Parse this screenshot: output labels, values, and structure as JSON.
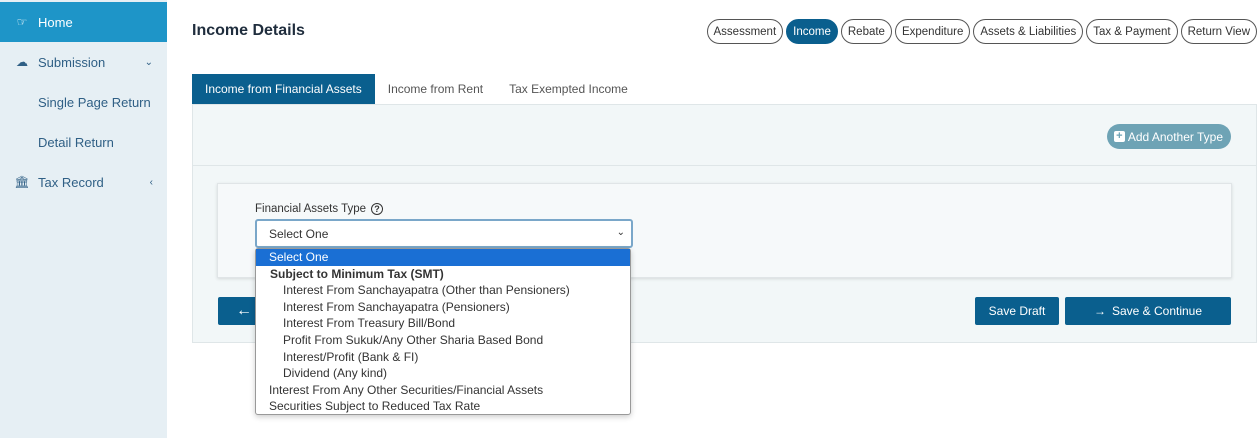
{
  "sidebar": {
    "items": [
      {
        "label": "Home",
        "icon": "hand-point-icon"
      },
      {
        "label": "Submission",
        "icon": "cloud-upload-icon"
      },
      {
        "label": "Single Page Return"
      },
      {
        "label": "Detail Return"
      },
      {
        "label": "Tax Record",
        "icon": "bank-icon"
      }
    ]
  },
  "header": {
    "title": "Income Details",
    "steps": [
      "Assessment",
      "Income",
      "Rebate",
      "Expenditure",
      "Assets & Liabilities",
      "Tax & Payment",
      "Return View"
    ]
  },
  "tabs": [
    "Income from Financial Assets",
    "Income from Rent",
    "Tax Exempted Income"
  ],
  "add_button": "Add Another Type",
  "form": {
    "label": "Financial Assets Type",
    "select_value": "Select One"
  },
  "dropdown": {
    "options": [
      "Select One",
      "Subject to Minimum Tax (SMT)",
      "Interest From Sanchayapatra (Other than Pensioners)",
      "Interest From Sanchayapatra (Pensioners)",
      "Interest From Treasury Bill/Bond",
      "Profit From Sukuk/Any Other Sharia Based Bond",
      "Interest/Profit (Bank & FI)",
      "Dividend (Any kind)",
      "Interest From Any Other Securities/Financial Assets",
      "Securities Subject to Reduced Tax Rate"
    ]
  },
  "buttons": {
    "save_draft": "Save Draft",
    "save_continue": "Save & Continue"
  },
  "colors": {
    "primary": "#0a5f8e",
    "sidebar_active": "#1e95c8",
    "sidebar_bg": "#e6eff4"
  }
}
